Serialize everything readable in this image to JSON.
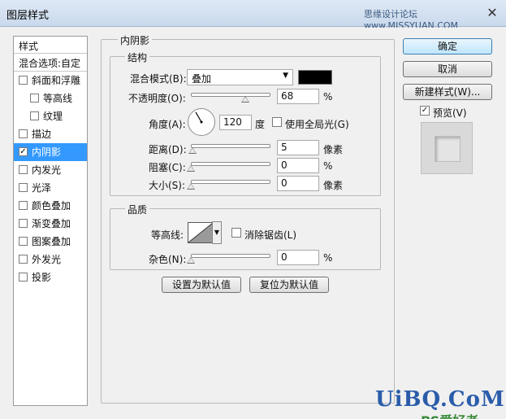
{
  "window": {
    "title": "图层样式",
    "watermark_top": "思缘设计论坛 www.MISSYUAN.COM",
    "close_glyph": "✕"
  },
  "left_list": {
    "header": "样式",
    "blend_options": "混合选项:自定",
    "items": [
      {
        "label": "斜面和浮雕",
        "checked": false,
        "sub": false
      },
      {
        "label": "等高线",
        "checked": false,
        "sub": true
      },
      {
        "label": "纹理",
        "checked": false,
        "sub": true
      },
      {
        "label": "描边",
        "checked": false,
        "sub": false
      },
      {
        "label": "内阴影",
        "checked": true,
        "sub": false,
        "selected": true
      },
      {
        "label": "内发光",
        "checked": false,
        "sub": false
      },
      {
        "label": "光泽",
        "checked": false,
        "sub": false
      },
      {
        "label": "颜色叠加",
        "checked": false,
        "sub": false
      },
      {
        "label": "渐变叠加",
        "checked": false,
        "sub": false
      },
      {
        "label": "图案叠加",
        "checked": false,
        "sub": false
      },
      {
        "label": "外发光",
        "checked": false,
        "sub": false
      },
      {
        "label": "投影",
        "checked": false,
        "sub": false
      }
    ]
  },
  "panel": {
    "title": "内阴影",
    "structure": {
      "title": "结构",
      "blend_mode_label": "混合模式(B):",
      "blend_mode_value": "叠加",
      "color": "#000000",
      "opacity_label": "不透明度(O):",
      "opacity_value": "68",
      "opacity_fraction": 0.68,
      "percent": "%",
      "angle_label": "角度(A):",
      "angle_value": "120",
      "angle_unit": "度",
      "global_light_label": "使用全局光(G)",
      "global_light_checked": false,
      "distance_label": "距离(D):",
      "distance_value": "5",
      "distance_fraction": 0.02,
      "px_unit": "像素",
      "choke_label": "阻塞(C):",
      "choke_value": "0",
      "choke_fraction": 0,
      "size_label": "大小(S):",
      "size_value": "0",
      "size_fraction": 0
    },
    "quality": {
      "title": "品质",
      "contour_label": "等高线:",
      "antialias_label": "消除锯齿(L)",
      "antialias_checked": false,
      "noise_label": "杂色(N):",
      "noise_value": "0",
      "noise_fraction": 0,
      "percent": "%"
    },
    "set_default": "设置为默认值",
    "reset_default": "复位为默认值"
  },
  "right": {
    "ok": "确定",
    "cancel": "取消",
    "new_style": "新建样式(W)...",
    "preview_label": "预览(V)",
    "preview_checked": true
  },
  "watermark_bottom": {
    "ps": "PS爱好者",
    "site": "UiBQ.CoM"
  }
}
